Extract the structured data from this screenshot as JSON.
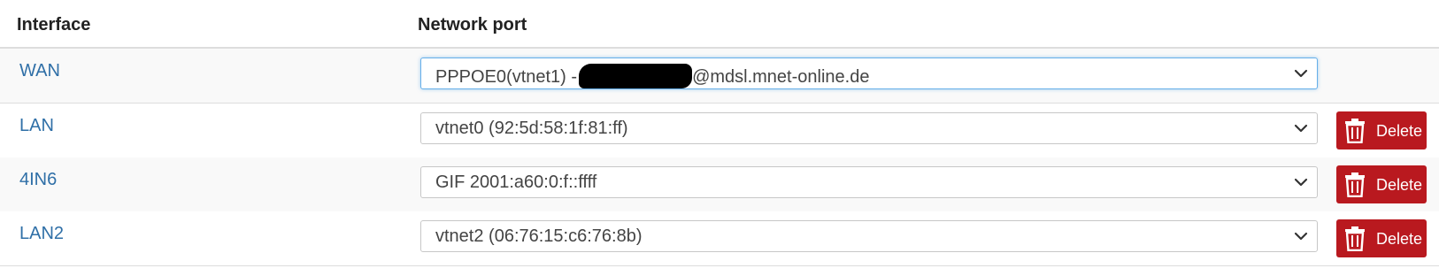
{
  "table": {
    "headers": {
      "interface": "Interface",
      "network_port": "Network port"
    },
    "rows": [
      {
        "interface": "WAN",
        "port_prefix": "PPPOE0(vtnet1) -",
        "port_suffix": "@mdsl.mnet-online.de",
        "has_delete": false
      },
      {
        "interface": "LAN",
        "port": "vtnet0 (92:5d:58:1f:81:ff)",
        "delete_label": "Delete",
        "has_delete": true
      },
      {
        "interface": "4IN6",
        "port": "GIF 2001:a60:0:f::ffff",
        "delete_label": "Delete",
        "has_delete": true
      },
      {
        "interface": "LAN2",
        "port": "vtnet2 (06:76:15:c6:76:8b)",
        "delete_label": "Delete",
        "has_delete": true
      }
    ]
  },
  "icons": {
    "select_arrow": "chevron-down-icon",
    "delete": "trash-icon"
  },
  "colors": {
    "link": "#2f6fa7",
    "delete_button": "#b9191f",
    "focus_border": "#66afe9"
  }
}
